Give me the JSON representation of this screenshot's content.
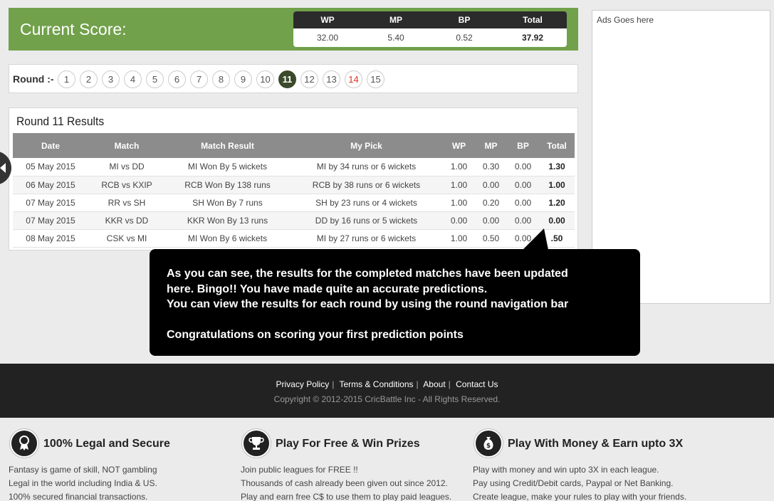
{
  "score": {
    "title": "Current Score:",
    "headers": [
      "WP",
      "MP",
      "BP",
      "Total"
    ],
    "values": [
      "32.00",
      "5.40",
      "0.52",
      "37.92"
    ]
  },
  "rounds": {
    "label": "Round :-",
    "items": [
      "1",
      "2",
      "3",
      "4",
      "5",
      "6",
      "7",
      "8",
      "9",
      "10",
      "11",
      "12",
      "13",
      "14",
      "15"
    ],
    "active": "11",
    "live": "14"
  },
  "results": {
    "title": "Round 11 Results",
    "headers": [
      "Date",
      "Match",
      "Match Result",
      "My Pick",
      "WP",
      "MP",
      "BP",
      "Total"
    ],
    "rows": [
      [
        "05 May 2015",
        "MI vs DD",
        "MI Won By 5 wickets",
        "MI by 34 runs or 6 wickets",
        "1.00",
        "0.30",
        "0.00",
        "1.30"
      ],
      [
        "06 May 2015",
        "RCB vs KXIP",
        "RCB Won By 138 runs",
        "RCB by 38 runs or 6 wickets",
        "1.00",
        "0.00",
        "0.00",
        "1.00"
      ],
      [
        "07 May 2015",
        "RR vs SH",
        "SH Won By 7 runs",
        "SH by 23 runs or 4 wickets",
        "1.00",
        "0.20",
        "0.00",
        "1.20"
      ],
      [
        "07 May 2015",
        "KKR vs DD",
        "KKR Won By 13 runs",
        "DD by 16 runs or 5 wickets",
        "0.00",
        "0.00",
        "0.00",
        "0.00"
      ],
      [
        "08 May 2015",
        "CSK vs MI",
        "MI Won By 6 wickets",
        "MI by 27 runs or 6 wickets",
        "1.00",
        "0.50",
        "0.00",
        ".50"
      ]
    ]
  },
  "ads": {
    "text": "Ads Goes here"
  },
  "tooltip": {
    "line1": "As you can see, the results for the completed matches have been updated",
    "line2": "here. Bingo!! You have made quite an accurate predictions.",
    "line3": "You can view the results for each round by using the round navigation bar",
    "line4": "Congratulations on scoring your first prediction points"
  },
  "footer": {
    "links": [
      "Privacy Policy",
      "Terms & Conditions",
      "About",
      "Contact Us"
    ],
    "copyright": "Copyright © 2012-2015 CricBattle Inc - All Rights Reserved."
  },
  "features": [
    {
      "icon": "award-icon",
      "title": "100% Legal and Secure",
      "lines": [
        "Fantasy is game of skill, NOT gambling",
        "Legal in the world including India & US.",
        "100% secured financial transactions."
      ]
    },
    {
      "icon": "trophy-icon",
      "title": "Play For Free & Win Prizes",
      "lines": [
        "Join public leagues for FREE !!",
        "Thousands of cash already been given out since 2012.",
        "Play and earn free C$ to use them to play paid leagues."
      ]
    },
    {
      "icon": "money-bag-icon",
      "title": "Play With Money & Earn upto 3X",
      "lines": [
        "Play with money and win upto 3X in each league.",
        "Pay using Credit/Debit cards, Paypal or Net Banking.",
        "Create league, make your rules to play with your friends."
      ]
    }
  ]
}
